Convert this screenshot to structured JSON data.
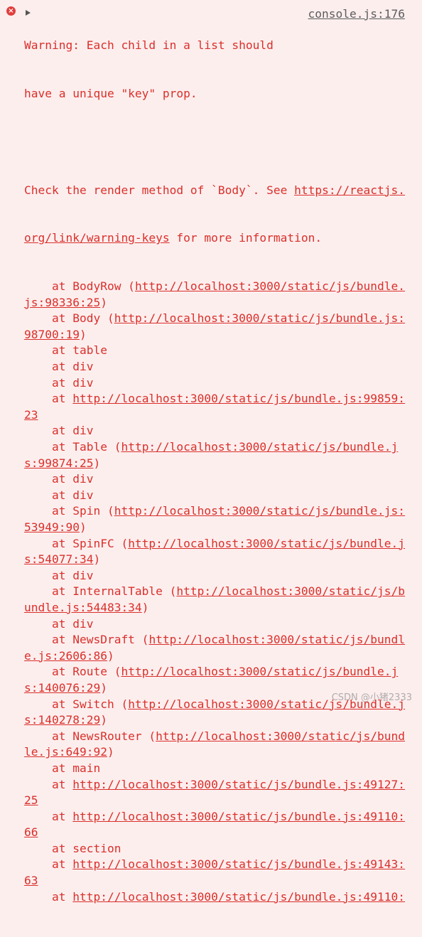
{
  "icons": {
    "error": "error-x-icon",
    "toggle": "triangle-right-icon"
  },
  "colors": {
    "background": "#fdeeee",
    "text": "#d9302a",
    "source_link": "#5c5c5c",
    "icon": "#e03e3e"
  },
  "entry": {
    "error_glyph": "×",
    "source": "console.js:176",
    "warning_lines": [
      "Warning: Each child in a list should",
      "have a unique \"key\" prop."
    ],
    "check_line1_text": "Check the render method of `Body`. See ",
    "check_line1_link": "https://reactjs.",
    "check_line2_link": "org/link/warning-keys",
    "check_line2_text": " for more information."
  },
  "stack": [
    {
      "prefix": "    at BodyRow (",
      "link": "http://localhost:3000/static/js/bundle.",
      "suffix": ""
    },
    {
      "prefix": "",
      "link": "js:98336:25",
      "suffix": ")"
    },
    {
      "prefix": "    at Body (",
      "link": "http://localhost:3000/static/js/bundle.js:",
      "suffix": ""
    },
    {
      "prefix": "",
      "link": "98700:19",
      "suffix": ")"
    },
    {
      "prefix": "    at table",
      "link": "",
      "suffix": ""
    },
    {
      "prefix": "    at div",
      "link": "",
      "suffix": ""
    },
    {
      "prefix": "    at div",
      "link": "",
      "suffix": ""
    },
    {
      "prefix": "    at ",
      "link": "http://localhost:3000/static/js/bundle.js:99859:",
      "suffix": ""
    },
    {
      "prefix": "",
      "link": "23",
      "suffix": ""
    },
    {
      "prefix": "    at div",
      "link": "",
      "suffix": ""
    },
    {
      "prefix": "    at Table (",
      "link": "http://localhost:3000/static/js/bundle.j",
      "suffix": ""
    },
    {
      "prefix": "",
      "link": "s:99874:25",
      "suffix": ")"
    },
    {
      "prefix": "    at div",
      "link": "",
      "suffix": ""
    },
    {
      "prefix": "    at div",
      "link": "",
      "suffix": ""
    },
    {
      "prefix": "    at Spin (",
      "link": "http://localhost:3000/static/js/bundle.js:",
      "suffix": ""
    },
    {
      "prefix": "",
      "link": "53949:90",
      "suffix": ")"
    },
    {
      "prefix": "    at SpinFC (",
      "link": "http://localhost:3000/static/js/bundle.j",
      "suffix": ""
    },
    {
      "prefix": "",
      "link": "s:54077:34",
      "suffix": ")"
    },
    {
      "prefix": "    at div",
      "link": "",
      "suffix": ""
    },
    {
      "prefix": "    at InternalTable (",
      "link": "http://localhost:3000/static/js/b",
      "suffix": ""
    },
    {
      "prefix": "",
      "link": "undle.js:54483:34",
      "suffix": ")"
    },
    {
      "prefix": "    at div",
      "link": "",
      "suffix": ""
    },
    {
      "prefix": "    at NewsDraft (",
      "link": "http://localhost:3000/static/js/bundl",
      "suffix": ""
    },
    {
      "prefix": "",
      "link": "e.js:2606:86",
      "suffix": ")"
    },
    {
      "prefix": "    at Route (",
      "link": "http://localhost:3000/static/js/bundle.j",
      "suffix": ""
    },
    {
      "prefix": "",
      "link": "s:140076:29",
      "suffix": ")"
    },
    {
      "prefix": "    at Switch (",
      "link": "http://localhost:3000/static/js/bundle.j",
      "suffix": ""
    },
    {
      "prefix": "",
      "link": "s:140278:29",
      "suffix": ")"
    },
    {
      "prefix": "    at NewsRouter (",
      "link": "http://localhost:3000/static/js/bund",
      "suffix": ""
    },
    {
      "prefix": "",
      "link": "le.js:649:92",
      "suffix": ")"
    },
    {
      "prefix": "    at main",
      "link": "",
      "suffix": ""
    },
    {
      "prefix": "    at ",
      "link": "http://localhost:3000/static/js/bundle.js:49127:",
      "suffix": ""
    },
    {
      "prefix": "",
      "link": "25",
      "suffix": ""
    },
    {
      "prefix": "    at ",
      "link": "http://localhost:3000/static/js/bundle.js:49110:",
      "suffix": ""
    },
    {
      "prefix": "",
      "link": "66",
      "suffix": ""
    },
    {
      "prefix": "    at section",
      "link": "",
      "suffix": ""
    },
    {
      "prefix": "    at ",
      "link": "http://localhost:3000/static/js/bundle.js:49143:",
      "suffix": ""
    },
    {
      "prefix": "",
      "link": "63",
      "suffix": ""
    },
    {
      "prefix": "    at ",
      "link": "http://localhost:3000/static/js/bundle.js:49110:",
      "suffix": ""
    }
  ],
  "watermark": "CSDN @小猪2333"
}
